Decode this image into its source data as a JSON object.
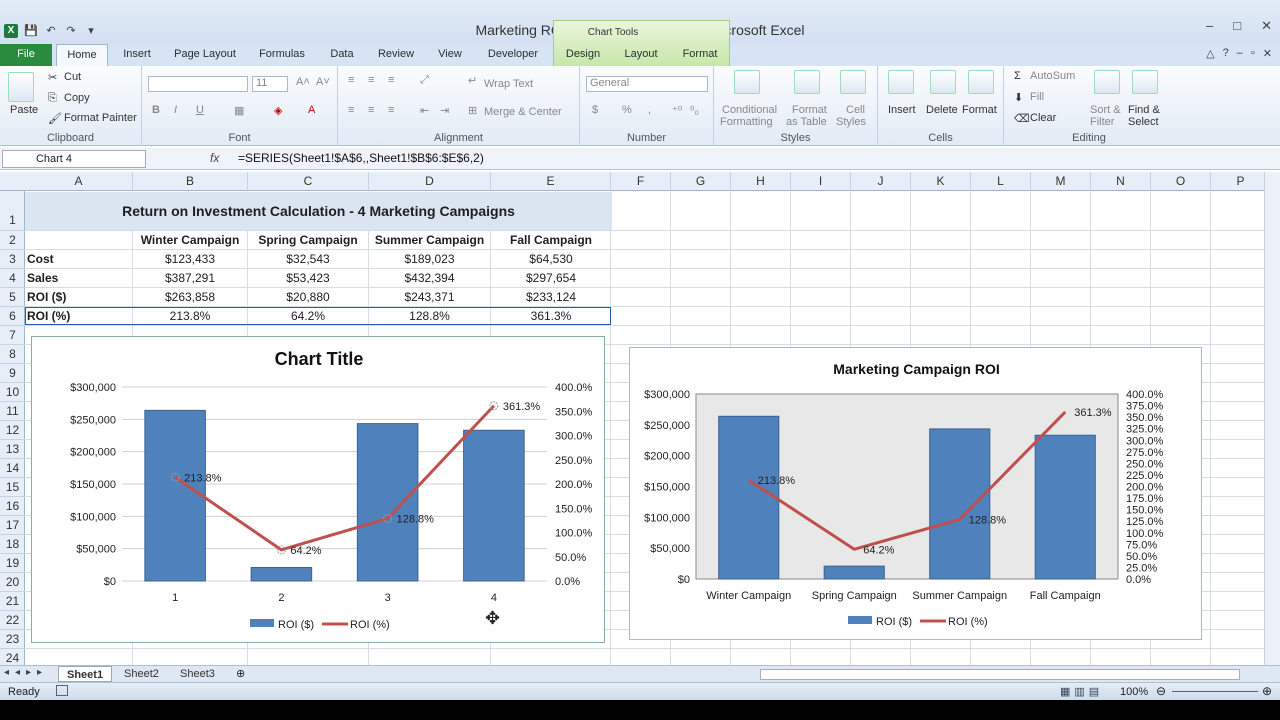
{
  "window": {
    "title": "Marketing ROI Calculation Example  -  Microsoft Excel",
    "controls": [
      "–",
      "□",
      "✕"
    ]
  },
  "tabs": [
    "File",
    "Home",
    "Insert",
    "Page Layout",
    "Formulas",
    "Data",
    "Review",
    "View",
    "Developer",
    "Design",
    "Layout",
    "Format"
  ],
  "chart_tools_label": "Chart Tools",
  "ribbon": {
    "clipboard": {
      "paste": "Paste",
      "cut": "Cut",
      "copy": "Copy",
      "format_painter": "Format Painter",
      "label": "Clipboard"
    },
    "font": {
      "size": "11",
      "label": "Font"
    },
    "alignment": {
      "wrap": "Wrap Text",
      "merge": "Merge & Center",
      "label": "Alignment"
    },
    "number": {
      "format": "General",
      "label": "Number",
      "dollar": "$",
      "percent": "%",
      "comma": ","
    },
    "styles": {
      "cond": "Conditional",
      "cond2": "Formatting",
      "fmt": "Format",
      "fmt2": "as Table",
      "cell": "Cell",
      "cell2": "Styles",
      "label": "Styles"
    },
    "cells": {
      "insert": "Insert",
      "delete": "Delete",
      "format": "Format",
      "label": "Cells"
    },
    "editing": {
      "autosum": "AutoSum",
      "fill": "Fill",
      "clear": "Clear",
      "sort": "Sort &",
      "sort2": "Filter",
      "find": "Find &",
      "find2": "Select",
      "label": "Editing"
    }
  },
  "formula_bar": {
    "name_box": "Chart 4",
    "fx": "fx",
    "formula": "=SERIES(Sheet1!$A$6,,Sheet1!$B$6:$E$6,2)"
  },
  "columns": [
    "A",
    "B",
    "C",
    "D",
    "E",
    "F",
    "G",
    "H",
    "I",
    "J",
    "K",
    "L",
    "M",
    "N",
    "O",
    "P"
  ],
  "rows": [
    "1",
    "2",
    "3",
    "4",
    "5",
    "6",
    "7",
    "8",
    "9",
    "10",
    "11",
    "12",
    "13",
    "14",
    "15",
    "16",
    "17",
    "18",
    "19",
    "20",
    "21",
    "22",
    "23",
    "24"
  ],
  "sheet": {
    "title": "Return on Investment Calculation - 4 Marketing Campaigns",
    "headers": [
      "Winter Campaign",
      "Spring Campaign",
      "Summer Campaign",
      "Fall Campaign"
    ],
    "rows": [
      {
        "label": "Cost",
        "values": [
          "$123,433",
          "$32,543",
          "$189,023",
          "$64,530"
        ]
      },
      {
        "label": "Sales",
        "values": [
          "$387,291",
          "$53,423",
          "$432,394",
          "$297,654"
        ]
      },
      {
        "label": "ROI ($)",
        "values": [
          "$263,858",
          "$20,880",
          "$243,371",
          "$233,124"
        ]
      },
      {
        "label": "ROI (%)",
        "values": [
          "213.8%",
          "64.2%",
          "128.8%",
          "361.3%"
        ]
      }
    ]
  },
  "chart_data": [
    {
      "type": "bar",
      "title": "Chart Title",
      "categories": [
        "1",
        "2",
        "3",
        "4"
      ],
      "series": [
        {
          "name": "ROI ($)",
          "type": "bar",
          "axis": "primary",
          "values": [
            263858,
            20880,
            243371,
            233124
          ],
          "color": "#4f81bd"
        },
        {
          "name": "ROI (%)",
          "type": "line",
          "axis": "secondary",
          "values": [
            213.8,
            64.2,
            128.8,
            361.3
          ],
          "color": "#c0504d"
        }
      ],
      "data_labels": [
        "213.8%",
        "64.2%",
        "128.8%",
        "361.3%"
      ],
      "y_ticks": [
        "$0",
        "$50,000",
        "$100,000",
        "$150,000",
        "$200,000",
        "$250,000",
        "$300,000"
      ],
      "y2_ticks": [
        "0.0%",
        "50.0%",
        "100.0%",
        "150.0%",
        "200.0%",
        "250.0%",
        "300.0%",
        "350.0%",
        "400.0%"
      ],
      "ylim": [
        0,
        300000
      ],
      "y2lim": [
        0,
        400
      ],
      "grid": true,
      "legend": "bottom"
    },
    {
      "type": "bar",
      "title": "Marketing Campaign ROI",
      "categories": [
        "Winter Campaign",
        "Spring Campaign",
        "Summer Campaign",
        "Fall Campaign"
      ],
      "series": [
        {
          "name": "ROI ($)",
          "type": "bar",
          "axis": "primary",
          "values": [
            263858,
            20880,
            243371,
            233124
          ],
          "color": "#4f81bd"
        },
        {
          "name": "ROI (%)",
          "type": "line",
          "axis": "secondary",
          "values": [
            213.8,
            64.2,
            128.8,
            361.3
          ],
          "color": "#c0504d"
        }
      ],
      "data_labels": [
        "213.8%",
        "64.2%",
        "128.8%",
        "361.3%"
      ],
      "y_ticks": [
        "$0",
        "$50,000",
        "$100,000",
        "$150,000",
        "$200,000",
        "$250,000",
        "$300,000"
      ],
      "y2_ticks": [
        "0.0%",
        "25.0%",
        "50.0%",
        "75.0%",
        "100.0%",
        "125.0%",
        "150.0%",
        "175.0%",
        "200.0%",
        "225.0%",
        "250.0%",
        "275.0%",
        "300.0%",
        "325.0%",
        "350.0%",
        "375.0%",
        "400.0%"
      ],
      "ylim": [
        0,
        300000
      ],
      "y2lim": [
        0,
        400
      ],
      "grid": false,
      "legend": "bottom"
    }
  ],
  "sheet_tabs": [
    "Sheet1",
    "Sheet2",
    "Sheet3"
  ],
  "status": {
    "ready": "Ready",
    "zoom": "100%"
  }
}
